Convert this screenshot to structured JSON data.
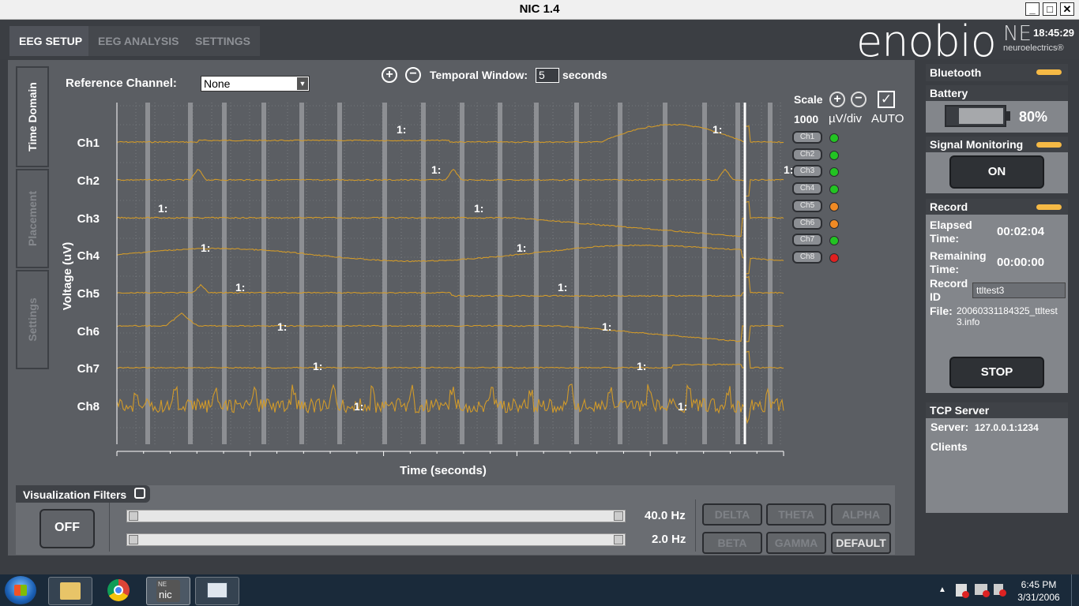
{
  "window": {
    "title": "NIC 1.4",
    "minimize": "_",
    "maximize": "□",
    "close": "✕"
  },
  "tabs": [
    "EEG SETUP",
    "EEG ANALYSIS",
    "SETTINGS"
  ],
  "brand": {
    "logo": "enobio",
    "ne_mark": "NE",
    "ne_text": "neuroelectrics®",
    "clock": "18:45:29"
  },
  "side_tabs": [
    "Time Domain",
    "Placement",
    "Settings"
  ],
  "controls": {
    "reference_label": "Reference Channel:",
    "reference_value": "None",
    "temporal_label": "Temporal Window:",
    "temporal_value": "5",
    "temporal_unit": "seconds",
    "scale_label": "Scale",
    "scale_value": "1000",
    "scale_unit": "µV/div",
    "auto_label": "AUTO"
  },
  "plot": {
    "ylabel": "Voltage (uV)",
    "xlabel": "Time (seconds)",
    "channels": [
      "Ch1",
      "Ch2",
      "Ch3",
      "Ch4",
      "Ch5",
      "Ch6",
      "Ch7",
      "Ch8"
    ],
    "marker_text": "1:"
  },
  "channel_status": [
    {
      "label": "Ch1",
      "color": "#22c422"
    },
    {
      "label": "Ch2",
      "color": "#22c422"
    },
    {
      "label": "Ch3",
      "color": "#22c422"
    },
    {
      "label": "Ch4",
      "color": "#22c422"
    },
    {
      "label": "Ch5",
      "color": "#f08a24"
    },
    {
      "label": "Ch6",
      "color": "#f08a24"
    },
    {
      "label": "Ch7",
      "color": "#22c422"
    },
    {
      "label": "Ch8",
      "color": "#e02020"
    }
  ],
  "filters": {
    "title": "Visualization Filters",
    "toggle": "OFF",
    "high_value": "40.0 Hz",
    "low_value": "2.0 Hz",
    "bands": [
      "DELTA",
      "THETA",
      "ALPHA",
      "BETA",
      "GAMMA",
      "DEFAULT"
    ]
  },
  "panel": {
    "bluetooth": "Bluetooth",
    "battery": "Battery",
    "battery_pct": "80%",
    "battery_level": 0.8,
    "signal": "Signal Monitoring",
    "signal_btn": "ON",
    "record": "Record",
    "elapsed_label": "Elapsed Time:",
    "elapsed": "00:02:04",
    "remaining_label": "Remaining Time:",
    "remaining": "00:00:00",
    "record_id_label": "Record ID",
    "record_id": "ttltest3",
    "file_label": "File:",
    "file": "20060331184325_ttltest3.info",
    "stop": "STOP",
    "tcp": "TCP Server",
    "server_label": "Server:",
    "server": "127.0.0.1:1234",
    "clients": "Clients",
    "accent": "#f5b945"
  },
  "taskbar": {
    "time": "6:45 PM",
    "date": "3/31/2006",
    "nic_badge": "NE",
    "nic_text": "nic"
  }
}
